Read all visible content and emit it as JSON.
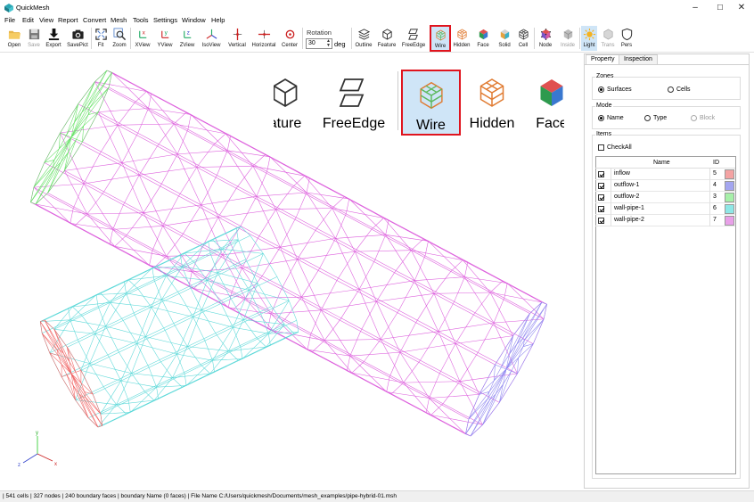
{
  "window": {
    "title": "QuickMesh",
    "minimize": "–",
    "maximize": "☐",
    "close": "✕"
  },
  "menu": [
    "File",
    "Edit",
    "View",
    "Report",
    "Convert",
    "Mesh",
    "Tools",
    "Settings",
    "Window",
    "Help"
  ],
  "toolbar": {
    "buttons": [
      {
        "id": "open",
        "label": "Open",
        "icon": "folder-icon"
      },
      {
        "id": "save",
        "label": "Save",
        "icon": "floppy-disk-icon",
        "disabled": true
      },
      {
        "id": "export",
        "label": "Export",
        "icon": "download-arrow-icon"
      },
      {
        "id": "savepict",
        "label": "SavePict",
        "icon": "camera-icon"
      },
      {
        "id": "fit",
        "label": "Fit",
        "icon": "fit-icon"
      },
      {
        "id": "zoom",
        "label": "Zoom",
        "icon": "magnifier-icon"
      },
      {
        "id": "xview",
        "label": "XView",
        "icon": "x-axis-view-icon"
      },
      {
        "id": "yview",
        "label": "YView",
        "icon": "y-axis-view-icon"
      },
      {
        "id": "zview",
        "label": "ZView",
        "icon": "z-axis-view-icon"
      },
      {
        "id": "isoview",
        "label": "IsoView",
        "icon": "iso-axis-view-icon"
      },
      {
        "id": "vertical",
        "label": "Vertical",
        "icon": "vertical-axis-icon"
      },
      {
        "id": "horizontal",
        "label": "Horizontal",
        "icon": "horizontal-axis-icon"
      },
      {
        "id": "center",
        "label": "Center",
        "icon": "target-center-icon"
      },
      {
        "id": "outline",
        "label": "Outline",
        "icon": "outline-layers-icon"
      },
      {
        "id": "feature",
        "label": "Feature",
        "icon": "feature-cube-icon"
      },
      {
        "id": "freeedge",
        "label": "FreeEdge",
        "icon": "free-edge-icon"
      },
      {
        "id": "wire",
        "label": "Wire",
        "icon": "wire-cube-icon",
        "active": true,
        "highlight": true
      },
      {
        "id": "hidden",
        "label": "Hidden",
        "icon": "hidden-cube-icon"
      },
      {
        "id": "face",
        "label": "Face",
        "icon": "face-cube-icon"
      },
      {
        "id": "solid",
        "label": "Solid",
        "icon": "solid-cube-icon"
      },
      {
        "id": "cell",
        "label": "Cell",
        "icon": "cell-cube-icon"
      },
      {
        "id": "node",
        "label": "Node",
        "icon": "node-cube-icon"
      },
      {
        "id": "inside",
        "label": "Inside",
        "icon": "inside-cube-icon",
        "disabled": true
      },
      {
        "id": "light",
        "label": "Light",
        "icon": "light-sun-icon",
        "active": true
      },
      {
        "id": "trans",
        "label": "Trans",
        "icon": "transparent-cube-icon",
        "disabled": true
      },
      {
        "id": "pers",
        "label": "Pers",
        "icon": "perspective-shield-icon"
      }
    ],
    "rotation": {
      "label": "Rotation",
      "value": "30",
      "unit": "deg"
    }
  },
  "zoom_inset": {
    "items": [
      "ature",
      "FreeEdge",
      "Wire",
      "Hidden",
      "Face"
    ],
    "highlighted": "Wire"
  },
  "panel": {
    "tabs": [
      "Property",
      "Inspection"
    ],
    "active_tab": "Property",
    "zones": {
      "title": "Zones",
      "options": [
        "Surfaces",
        "Cells"
      ],
      "selected": "Surfaces"
    },
    "mode": {
      "title": "Mode",
      "options": [
        "Name",
        "Type",
        "Block"
      ],
      "selected": "Name",
      "disabled": [
        "Block"
      ]
    },
    "items": {
      "title": "Items",
      "check_all": "CheckAll",
      "columns": [
        "Name",
        "ID"
      ],
      "rows": [
        {
          "name": "inflow",
          "id": "5",
          "color": "#f4a3a3",
          "checked": true
        },
        {
          "name": "outflow-1",
          "id": "4",
          "color": "#a4a6f0",
          "checked": true
        },
        {
          "name": "outflow-2",
          "id": "3",
          "color": "#a7f0a9",
          "checked": true
        },
        {
          "name": "wall-pipe-1",
          "id": "6",
          "color": "#8ee7e6",
          "checked": true
        },
        {
          "name": "wall-pipe-2",
          "id": "7",
          "color": "#e8a0e8",
          "checked": true
        }
      ]
    }
  },
  "mesh_colors": {
    "inflow": "#f06060",
    "outflow1": "#8c84f0",
    "outflow2": "#60e060",
    "pipe1": "#5ad8d8",
    "pipe2": "#dc5cdc"
  },
  "axes": {
    "x": "x",
    "y": "y",
    "z": "z"
  },
  "status": "| 541 cells | 327 nodes | 240 boundary faces |  boundary Name  (0 faces) | File Name C:/Users/quickmesh/Documents/mesh_examples/pipe-hybrid-01.msh"
}
